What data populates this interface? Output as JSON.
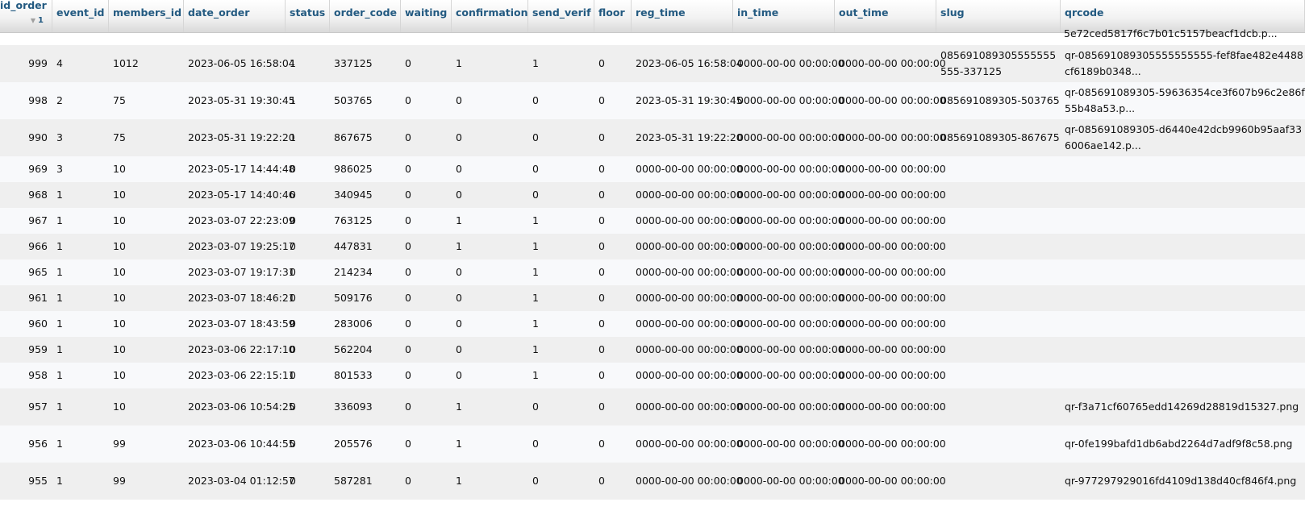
{
  "columns": [
    {
      "key": "id_order",
      "label": "id_order"
    },
    {
      "key": "event_id",
      "label": "event_id"
    },
    {
      "key": "members_id",
      "label": "members_id"
    },
    {
      "key": "date_order",
      "label": "date_order"
    },
    {
      "key": "status",
      "label": "status"
    },
    {
      "key": "order_code",
      "label": "order_code"
    },
    {
      "key": "waiting",
      "label": "waiting"
    },
    {
      "key": "confirmation",
      "label": "confirmation"
    },
    {
      "key": "send_verif",
      "label": "send_verif"
    },
    {
      "key": "floor",
      "label": "floor"
    },
    {
      "key": "reg_time",
      "label": "reg_time"
    },
    {
      "key": "in_time",
      "label": "in_time"
    },
    {
      "key": "out_time",
      "label": "out_time"
    },
    {
      "key": "slug",
      "label": "slug"
    },
    {
      "key": "qrcode",
      "label": "qrcode"
    }
  ],
  "sort": {
    "arrow_icon": "sort-down-arrow-icon",
    "arrow": "▼",
    "order": "1"
  },
  "partial_top_row": {
    "qrcode": "5e72ced5817f6c7b01c5157beacf1dcb.p..."
  },
  "rows": [
    [
      "999",
      "4",
      "1012",
      "2023-06-05 16:58:04",
      "1",
      "337125",
      "0",
      "1",
      "1",
      "0",
      "2023-06-05 16:58:04",
      "0000-00-00 00:00:00",
      "0000-00-00 00:00:00",
      "085691089305555555555-337125",
      "qr-085691089305555555555-fef8fae482e4488cf6189b0348..."
    ],
    [
      "998",
      "2",
      "75",
      "2023-05-31 19:30:45",
      "1",
      "503765",
      "0",
      "0",
      "0",
      "0",
      "2023-05-31 19:30:45",
      "0000-00-00 00:00:00",
      "0000-00-00 00:00:00",
      "085691089305-503765",
      "qr-085691089305-59636354ce3f607b96c2e86f55b48a53.p..."
    ],
    [
      "990",
      "3",
      "75",
      "2023-05-31 19:22:20",
      "1",
      "867675",
      "0",
      "0",
      "0",
      "0",
      "2023-05-31 19:22:20",
      "0000-00-00 00:00:00",
      "0000-00-00 00:00:00",
      "085691089305-867675",
      "qr-085691089305-d6440e42dcb9960b95aaf336006ae142.p..."
    ],
    [
      "969",
      "3",
      "10",
      "2023-05-17 14:44:48",
      "0",
      "986025",
      "0",
      "0",
      "0",
      "0",
      "0000-00-00 00:00:00",
      "0000-00-00 00:00:00",
      "0000-00-00 00:00:00",
      "",
      ""
    ],
    [
      "968",
      "1",
      "10",
      "2023-05-17 14:40:46",
      "0",
      "340945",
      "0",
      "0",
      "0",
      "0",
      "0000-00-00 00:00:00",
      "0000-00-00 00:00:00",
      "0000-00-00 00:00:00",
      "",
      ""
    ],
    [
      "967",
      "1",
      "10",
      "2023-03-07 22:23:09",
      "0",
      "763125",
      "0",
      "1",
      "1",
      "0",
      "0000-00-00 00:00:00",
      "0000-00-00 00:00:00",
      "0000-00-00 00:00:00",
      "",
      ""
    ],
    [
      "966",
      "1",
      "10",
      "2023-03-07 19:25:17",
      "0",
      "447831",
      "0",
      "1",
      "1",
      "0",
      "0000-00-00 00:00:00",
      "0000-00-00 00:00:00",
      "0000-00-00 00:00:00",
      "",
      ""
    ],
    [
      "965",
      "1",
      "10",
      "2023-03-07 19:17:31",
      "0",
      "214234",
      "0",
      "0",
      "1",
      "0",
      "0000-00-00 00:00:00",
      "0000-00-00 00:00:00",
      "0000-00-00 00:00:00",
      "",
      ""
    ],
    [
      "961",
      "1",
      "10",
      "2023-03-07 18:46:21",
      "0",
      "509176",
      "0",
      "0",
      "1",
      "0",
      "0000-00-00 00:00:00",
      "0000-00-00 00:00:00",
      "0000-00-00 00:00:00",
      "",
      ""
    ],
    [
      "960",
      "1",
      "10",
      "2023-03-07 18:43:59",
      "0",
      "283006",
      "0",
      "0",
      "1",
      "0",
      "0000-00-00 00:00:00",
      "0000-00-00 00:00:00",
      "0000-00-00 00:00:00",
      "",
      ""
    ],
    [
      "959",
      "1",
      "10",
      "2023-03-06 22:17:10",
      "0",
      "562204",
      "0",
      "0",
      "1",
      "0",
      "0000-00-00 00:00:00",
      "0000-00-00 00:00:00",
      "0000-00-00 00:00:00",
      "",
      ""
    ],
    [
      "958",
      "1",
      "10",
      "2023-03-06 22:15:11",
      "0",
      "801533",
      "0",
      "0",
      "1",
      "0",
      "0000-00-00 00:00:00",
      "0000-00-00 00:00:00",
      "0000-00-00 00:00:00",
      "",
      ""
    ],
    [
      "957",
      "1",
      "10",
      "2023-03-06 10:54:25",
      "0",
      "336093",
      "0",
      "1",
      "0",
      "0",
      "0000-00-00 00:00:00",
      "0000-00-00 00:00:00",
      "0000-00-00 00:00:00",
      "",
      "qr-f3a71cf60765edd14269d28819d15327.png"
    ],
    [
      "956",
      "1",
      "99",
      "2023-03-06 10:44:55",
      "0",
      "205576",
      "0",
      "1",
      "0",
      "0",
      "0000-00-00 00:00:00",
      "0000-00-00 00:00:00",
      "0000-00-00 00:00:00",
      "",
      "qr-0fe199bafd1db6abd2264d7adf9f8c58.png"
    ],
    [
      "955",
      "1",
      "99",
      "2023-03-04 01:12:57",
      "0",
      "587281",
      "0",
      "1",
      "0",
      "0",
      "0000-00-00 00:00:00",
      "0000-00-00 00:00:00",
      "0000-00-00 00:00:00",
      "",
      "qr-977297929016fd4109d138d40cf846f4.png"
    ]
  ]
}
